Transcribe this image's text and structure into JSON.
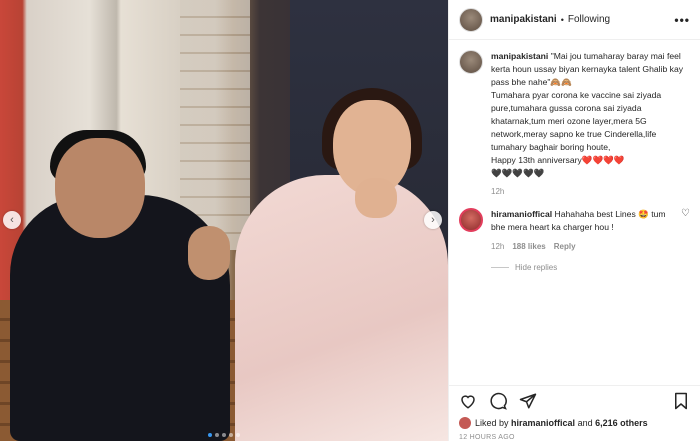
{
  "post": {
    "username": "manipakistani",
    "follow_status": "Following",
    "more_label": "•••"
  },
  "caption": {
    "username": "manipakistani",
    "text": "\"Mai jou tumaharay baray mai feel kerta houn ussay biyan kernayka talent Ghalib kay pass bhe nahe\"🙈🙈",
    "text2": "Tumahara pyar corona ke vaccine sai ziyada pure,tumahara gussa corona sai ziyada khatarnak,tum meri ozone layer,mera 5G network,meray sapno ke true Cinderella,life tumahary baghair boring houte,",
    "text3": "Happy 13th anniversary❤️❤️❤️❤️",
    "text4": "🖤🖤🖤🖤🖤",
    "time": "12h"
  },
  "reply": {
    "username": "hiramanioffical",
    "text": "Hahahaha best Lines 🤩 tum bhe mera heart ka charger hou !",
    "time": "12h",
    "likes": "188 likes",
    "reply_label": "Reply",
    "hide_label": "Hide replies"
  },
  "likes": {
    "prefix": "Liked by",
    "user": "hiramanioffical",
    "conj": "and",
    "others": "6,216 others"
  },
  "timestamp": "12 HOURS AGO",
  "carousel": {
    "total": 5,
    "active": 1
  },
  "icons": [
    "heart-icon",
    "comment-icon",
    "share-icon",
    "bookmark-icon",
    "chevron-left-icon",
    "chevron-right-icon"
  ],
  "colors": {
    "accent": "#3897f0",
    "muted": "#8e8e8e"
  }
}
